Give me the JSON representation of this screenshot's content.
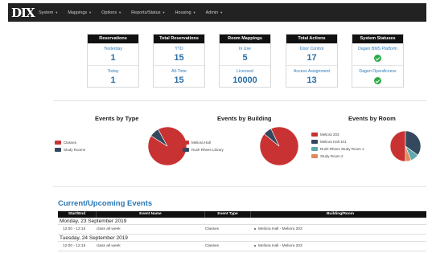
{
  "nav": {
    "logo": "DIX",
    "items": [
      "System",
      "Mappings",
      "Options",
      "Reports/Status",
      "Housing",
      "Admin"
    ]
  },
  "stats": [
    {
      "header": "Reservations",
      "cells": [
        {
          "label": "Yesterday",
          "value": "1"
        },
        {
          "label": "Today",
          "value": "1"
        }
      ]
    },
    {
      "header": "Total Reservations",
      "cells": [
        {
          "label": "YTD",
          "value": "15"
        },
        {
          "label": "All-Time",
          "value": "15"
        }
      ]
    },
    {
      "header": "Room Mappings",
      "cells": [
        {
          "label": "In Use",
          "value": "5"
        },
        {
          "label": "Licensed",
          "value": "10000"
        }
      ]
    },
    {
      "header": "Total Actions",
      "cells": [
        {
          "label": "Door Control",
          "value": "17"
        },
        {
          "label": "Access Assignment",
          "value": "13"
        }
      ]
    },
    {
      "header": "System Statuses",
      "cells": [
        {
          "label": "Dagen BMS Platform",
          "icon": "check-circle-icon",
          "status": "ok"
        },
        {
          "label": "Dagen OpenAccess",
          "icon": "check-circle-icon",
          "status": "ok"
        }
      ]
    }
  ],
  "chart_data": [
    {
      "type": "pie",
      "title": "Events by Type",
      "labels": [
        "Classes",
        "Study Rooms"
      ],
      "values": [
        92,
        8
      ],
      "colors": [
        "#c93232",
        "#34495e"
      ]
    },
    {
      "type": "pie",
      "title": "Events by Building",
      "labels": [
        "Meliora Hall",
        "Rush Rhees Library"
      ],
      "values": [
        93,
        7
      ],
      "colors": [
        "#c93232",
        "#34495e"
      ]
    },
    {
      "type": "pie",
      "title": "Events by Room",
      "labels": [
        "Meliora 203",
        "Meliora Hall 101",
        "Rush Rhees Study Room 1",
        "Study Room 2"
      ],
      "values": [
        50,
        35,
        9,
        6
      ],
      "colors": [
        "#c93232",
        "#34495e",
        "#5fa8ad",
        "#e08a5a"
      ]
    }
  ],
  "events": {
    "title": "Current/Upcoming Events",
    "columns": [
      "Start/End",
      "Event Name",
      "Event Type",
      "Building/Room"
    ],
    "days": [
      {
        "date": "Monday, 23 September 2019",
        "rows": [
          {
            "time": "12:00 - 12:15",
            "name": "class all week",
            "type": "Classes",
            "room": "Meliora Hall - Meliora 203"
          }
        ]
      },
      {
        "date": "Tuesday, 24 September 2019",
        "rows": [
          {
            "time": "12:00 - 12:15",
            "name": "class all week",
            "type": "Classes",
            "room": "Meliora Hall - Meliora 203"
          }
        ]
      }
    ]
  }
}
